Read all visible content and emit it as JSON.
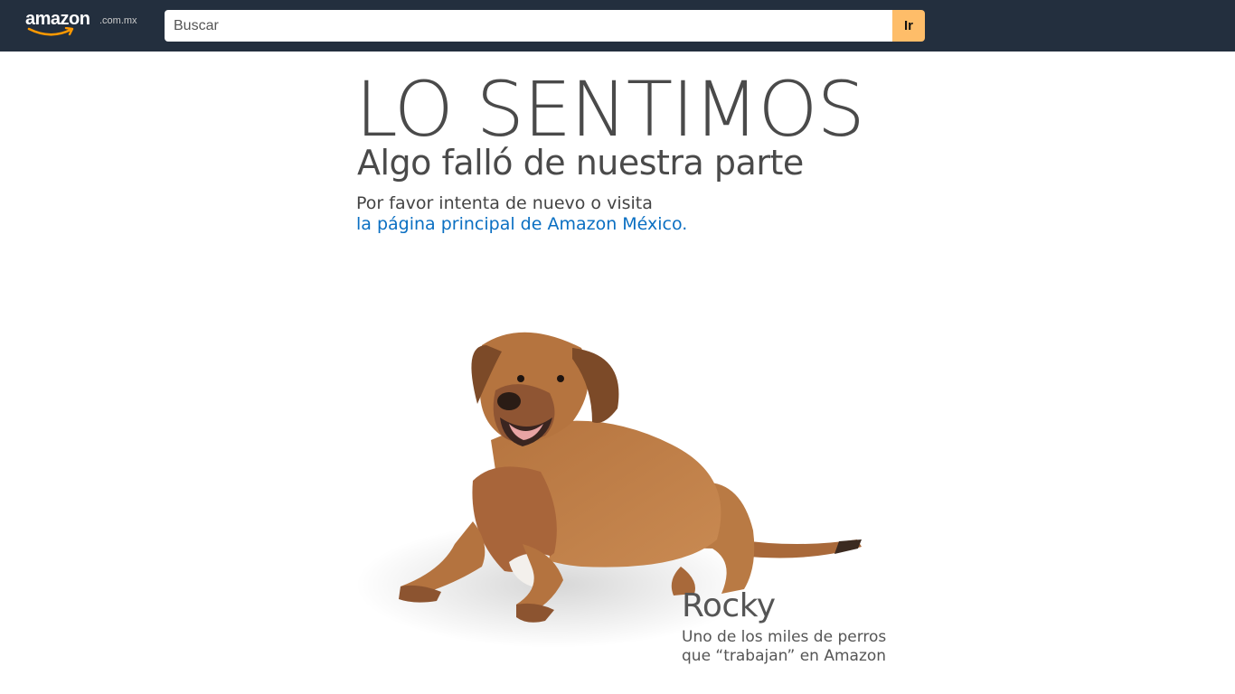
{
  "header": {
    "logo_text": "amazon",
    "logo_tld": ".com.mx",
    "search_placeholder": "Buscar",
    "search_button_label": "Ir"
  },
  "error": {
    "headline": "LO SENTIMOS",
    "subheadline": "Algo falló de nuestra parte",
    "message": "Por favor intenta de nuevo o visita",
    "link_text": "la página principal de Amazon México."
  },
  "dog": {
    "name": "Rocky",
    "description": "Uno de los miles de perros que “trabajan” en Amazon"
  },
  "colors": {
    "topbar": "#232f3e",
    "search_button": "#febd69",
    "link": "#0a6fc2",
    "text": "#4a4a4a"
  }
}
